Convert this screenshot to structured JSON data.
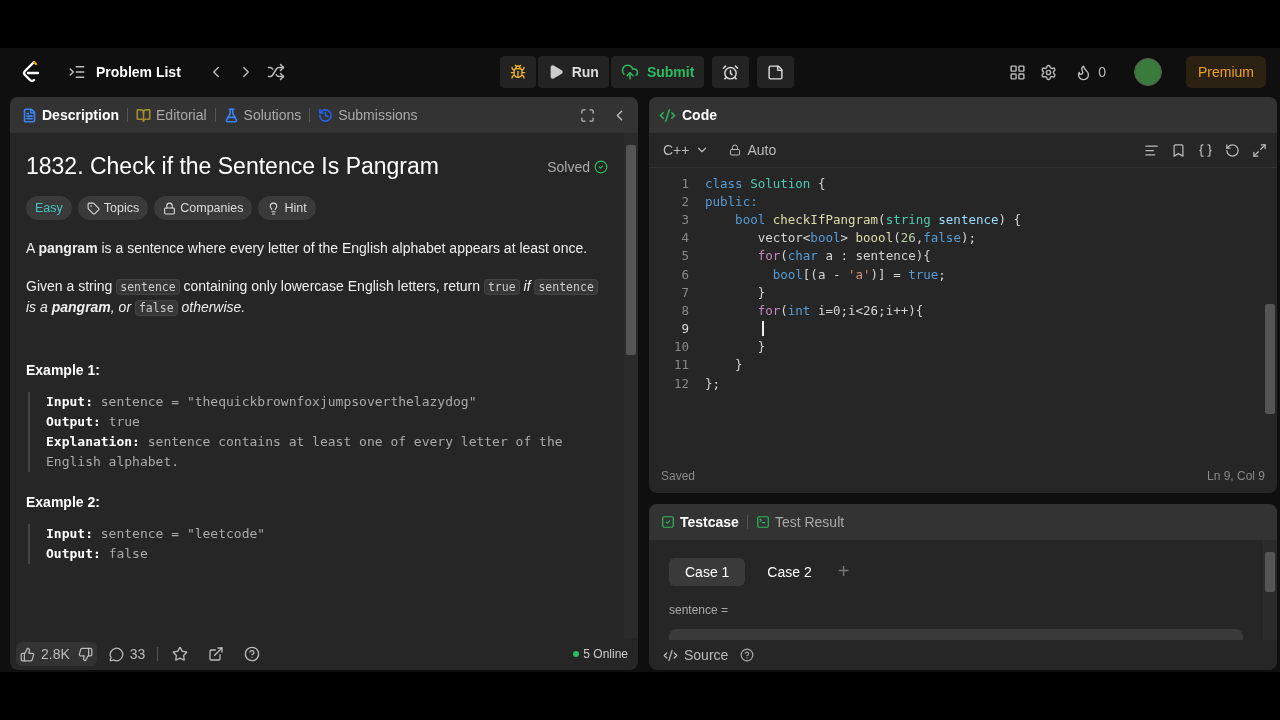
{
  "topbar": {
    "problem_list": "Problem List",
    "run": "Run",
    "submit": "Submit",
    "streak": "0",
    "premium": "Premium"
  },
  "description_panel": {
    "tabs": [
      {
        "label": "Description",
        "selected": true,
        "color": "#3b82f6"
      },
      {
        "label": "Editorial",
        "selected": false,
        "color": "#a38a2e"
      },
      {
        "label": "Solutions",
        "selected": false,
        "color": "#3b82f6"
      },
      {
        "label": "Submissions",
        "selected": false,
        "color": "#2563eb"
      }
    ],
    "title": "1832. Check if the Sentence Is Pangram",
    "status": "Solved",
    "tags": [
      {
        "label": "Easy",
        "kind": "difficulty"
      },
      {
        "label": "Topics",
        "kind": "topics"
      },
      {
        "label": "Companies",
        "kind": "companies"
      },
      {
        "label": "Hint",
        "kind": "hint"
      }
    ],
    "paragraphs": [
      [
        {
          "kind": "text",
          "text": "A **pangram** is a sentence where every letter of the English alphabet appears at least once."
        }
      ],
      [
        {
          "kind": "text",
          "text": "Given a string"
        },
        {
          "kind": "code",
          "text": "sentence"
        },
        {
          "kind": "text",
          "text": "containing only lowercase English letters, return"
        },
        {
          "kind": "code",
          "text": "true"
        },
        {
          "kind": "italic",
          "text": "if"
        },
        {
          "kind": "code",
          "text": "sentence"
        },
        {
          "kind": "italic",
          "text": "is a **pangram**, or"
        },
        {
          "kind": "code",
          "text": "false"
        },
        {
          "kind": "italic",
          "text": "otherwise."
        }
      ]
    ],
    "examples": [
      {
        "heading": "Example 1:",
        "lines": [
          {
            "label": "Input:",
            "value": "sentence = \"thequickbrownfoxjumpsoverthelazydog\""
          },
          {
            "label": "Output:",
            "value": "true"
          },
          {
            "label": "Explanation:",
            "value": "sentence contains at least one of every letter of the English alphabet."
          }
        ]
      },
      {
        "heading": "Example 2:",
        "lines": [
          {
            "label": "Input:",
            "value": "sentence = \"leetcode\""
          },
          {
            "label": "Output:",
            "value": "false"
          }
        ]
      }
    ],
    "footer": {
      "likes": "2.8K",
      "comments": "33",
      "online": "5 Online"
    }
  },
  "code_panel": {
    "title": "Code",
    "language": "C++",
    "mode": "Auto",
    "lines": [
      {
        "number": "1",
        "active": false,
        "tokens": [
          {
            "kind": "keyword",
            "text": "class "
          },
          {
            "kind": "type",
            "text": "Solution"
          },
          {
            "kind": "plain",
            "text": " {"
          }
        ]
      },
      {
        "number": "2",
        "active": false,
        "tokens": [
          {
            "kind": "keyword",
            "text": "public:"
          }
        ]
      },
      {
        "number": "3",
        "active": false,
        "tokens": [
          {
            "kind": "keyword",
            "text": "    bool "
          },
          {
            "kind": "function",
            "text": "checkIfPangram"
          },
          {
            "kind": "plain",
            "text": "("
          },
          {
            "kind": "type",
            "text": "string "
          },
          {
            "kind": "variable",
            "text": "sentence"
          },
          {
            "kind": "plain",
            "text": ") {"
          }
        ]
      },
      {
        "number": "4",
        "active": false,
        "tokens": [
          {
            "kind": "plain",
            "text": "       vector<"
          },
          {
            "kind": "keyword",
            "text": "bool"
          },
          {
            "kind": "plain",
            "text": "> "
          },
          {
            "kind": "function",
            "text": "boool"
          },
          {
            "kind": "plain",
            "text": "("
          },
          {
            "kind": "number",
            "text": "26"
          },
          {
            "kind": "plain",
            "text": ","
          },
          {
            "kind": "keyword",
            "text": "false"
          },
          {
            "kind": "plain",
            "text": ");"
          }
        ]
      },
      {
        "number": "5",
        "active": false,
        "tokens": [
          {
            "kind": "control",
            "text": "       for"
          },
          {
            "kind": "plain",
            "text": "("
          },
          {
            "kind": "keyword",
            "text": "char"
          },
          {
            "kind": "plain",
            "text": " a : sentence){"
          }
        ]
      },
      {
        "number": "6",
        "active": false,
        "tokens": [
          {
            "kind": "keyword",
            "text": "         bool"
          },
          {
            "kind": "plain",
            "text": "[(a - "
          },
          {
            "kind": "string",
            "text": "'a'"
          },
          {
            "kind": "plain",
            "text": ")] = "
          },
          {
            "kind": "keyword",
            "text": "true"
          },
          {
            "kind": "plain",
            "text": ";"
          }
        ]
      },
      {
        "number": "7",
        "active": false,
        "tokens": [
          {
            "kind": "plain",
            "text": "       }"
          }
        ]
      },
      {
        "number": "8",
        "active": false,
        "tokens": [
          {
            "kind": "control",
            "text": "       for"
          },
          {
            "kind": "plain",
            "text": "("
          },
          {
            "kind": "keyword",
            "text": "int"
          },
          {
            "kind": "plain",
            "text": " i=0;i<26;i++){"
          }
        ]
      },
      {
        "number": "9",
        "active": true
      },
      {
        "number": "10",
        "active": false,
        "tokens": [
          {
            "kind": "plain",
            "text": "       }"
          }
        ]
      },
      {
        "number": "11",
        "active": false,
        "tokens": [
          {
            "kind": "plain",
            "text": "    }"
          }
        ]
      },
      {
        "number": "12",
        "active": false,
        "tokens": [
          {
            "kind": "plain",
            "text": "};"
          }
        ]
      }
    ],
    "saved": "Saved",
    "position": "Ln 9, Col 9"
  },
  "testcase_panel": {
    "tabs": [
      {
        "label": "Testcase",
        "selected": true
      },
      {
        "label": "Test Result",
        "selected": false
      }
    ],
    "cases": [
      {
        "label": "Case 1",
        "selected": true
      },
      {
        "label": "Case 2",
        "selected": false
      }
    ],
    "add": "+",
    "param_label": "sentence =",
    "source": "Source"
  }
}
